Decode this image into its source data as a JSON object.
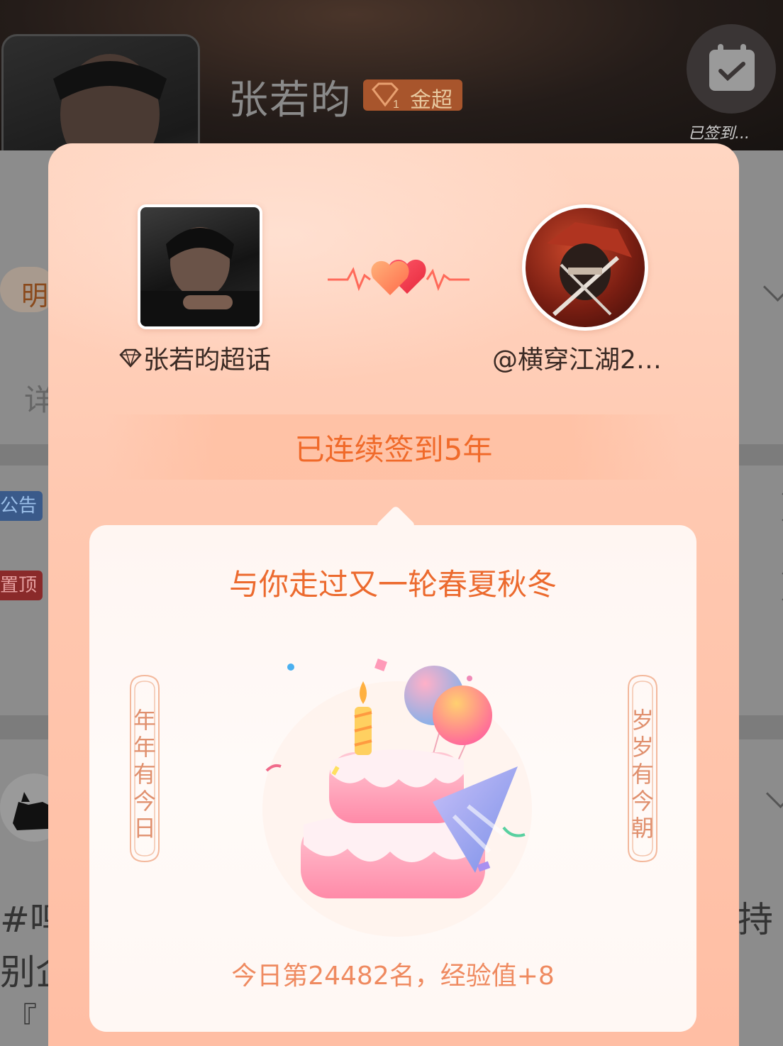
{
  "background": {
    "title": "张若昀",
    "badge_label": "金超",
    "badge_level": "1",
    "calendar_caption": "已签到...",
    "tab_label": "明",
    "detail_label": "详",
    "tag_notice": "公告",
    "tag_pinned": "置顶",
    "post_line1": "#鸣",
    "post_line2": "别企",
    "post_line3": "『",
    "post_side": "持"
  },
  "modal": {
    "left_name": "张若昀超话",
    "right_name": "@横穿江湖2…",
    "streak": "已连续签到5年",
    "card_title": "与你走过又一轮春夏秋冬",
    "scroll_left": [
      "年",
      "年",
      "有",
      "今",
      "日"
    ],
    "scroll_right": [
      "岁",
      "岁",
      "有",
      "今",
      "朝"
    ],
    "rank": "今日第24482名，经验值+8"
  },
  "colors": {
    "accent": "#f06a2a",
    "modal_bg": "#ffc8b0",
    "card_bg": "#fff6f2",
    "scroll_text": "#e0906e"
  }
}
